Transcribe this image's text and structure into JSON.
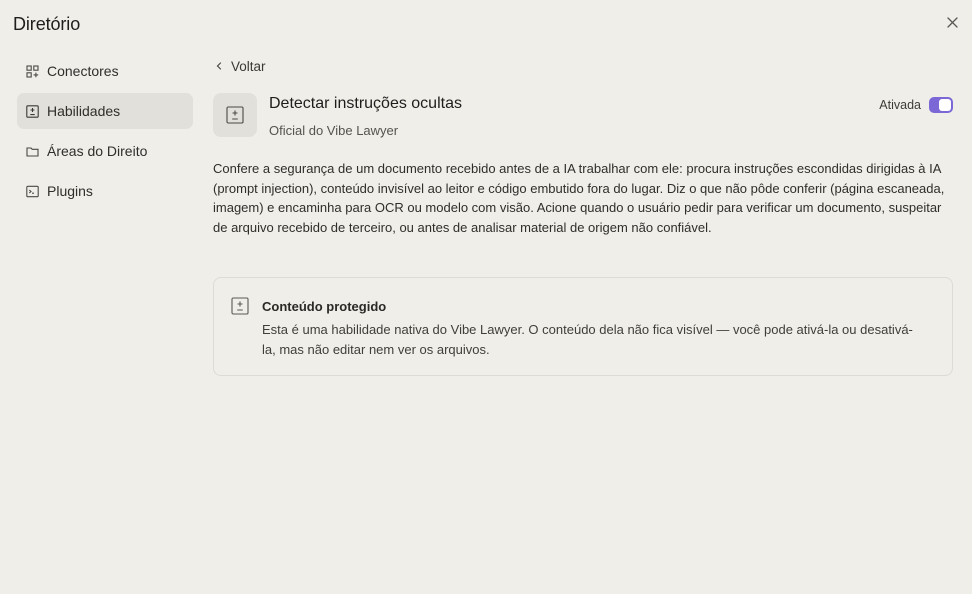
{
  "dialog": {
    "title": "Diretório"
  },
  "sidebar": {
    "items": [
      {
        "label": "Conectores",
        "icon": "connectors-grid-icon",
        "active": false
      },
      {
        "label": "Habilidades",
        "icon": "skill-box-icon",
        "active": true
      },
      {
        "label": "Áreas do Direito",
        "icon": "folder-icon",
        "active": false
      },
      {
        "label": "Plugins",
        "icon": "terminal-plugin-icon",
        "active": false
      }
    ]
  },
  "main": {
    "back_label": "Voltar",
    "skill": {
      "title": "Detectar instruções ocultas",
      "subtitle": "Oficial do Vibe Lawyer",
      "toggle_label": "Ativada",
      "enabled": true,
      "description": "Confere a segurança de um documento recebido antes de a IA trabalhar com ele: procura instruções escondidas dirigidas à IA (prompt injection), conteúdo invisível ao leitor e código embutido fora do lugar. Diz o que não pôde conferir (página escaneada, imagem) e encaminha para OCR ou modelo com visão. Acione quando o usuário pedir para verificar um documento, suspeitar de arquivo recebido de terceiro, ou antes de analisar material de origem não confiável."
    },
    "notice": {
      "title": "Conteúdo protegido",
      "body": "Esta é uma habilidade nativa do Vibe Lawyer. O conteúdo dela não fica visível — você pode ativá-la ou desativá-la, mas não editar nem ver os arquivos."
    }
  },
  "colors": {
    "background": "#efeee9",
    "active_nav": "#e1e0da",
    "toggle_accent": "#7b68d6",
    "border": "#dcdbd4"
  }
}
